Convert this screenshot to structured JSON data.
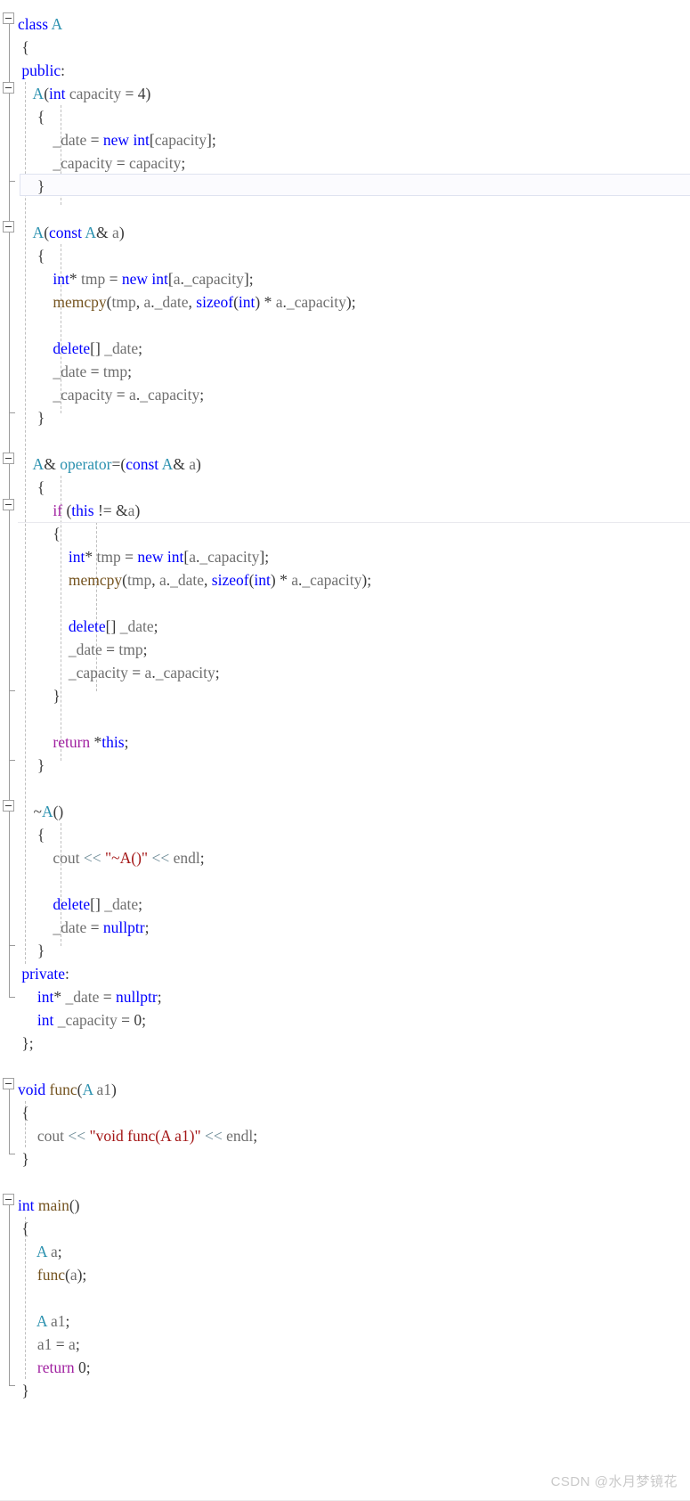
{
  "editor": {
    "app": "visual-studio-code-editor",
    "language": "C++",
    "font_size_px": 17.5,
    "line_height_px": 26,
    "background": "#ffffff",
    "current_line_index": 7,
    "colors": {
      "keyword": "#0000ff",
      "control_keyword": "#a020a0",
      "user_type": "#2b91af",
      "function": "#74531f",
      "identifier": "#6f6f6f",
      "punctuation": "#3a3a3a",
      "string": "#a31515",
      "stream_operator": "#6c8a96",
      "indent_guide": "#bfbfbf",
      "fold_spine": "#9a9a9a",
      "current_line_border": "#dfe3f0",
      "watermark": "#c9c9c9"
    }
  },
  "watermark": {
    "prefix": "CSDN",
    "handle": "@水月梦镜花",
    "full": "CSDN @水月梦镜花"
  },
  "code": {
    "lines": [
      "class A",
      "{",
      "public:",
      "    A(int capacity = 4)",
      "    {",
      "        _date = new int[capacity];",
      "        _capacity = capacity;",
      "    }",
      "",
      "    A(const A& a)",
      "    {",
      "        int* tmp = new int[a._capacity];",
      "        memcpy(tmp, a._date, sizeof(int) * a._capacity);",
      "",
      "        delete[] _date;",
      "        _date = tmp;",
      "        _capacity = a._capacity;",
      "    }",
      "",
      "    A& operator=(const A& a)",
      "    {",
      "        if (this != &a)",
      "        {",
      "            int* tmp = new int[a._capacity];",
      "            memcpy(tmp, a._date, sizeof(int) * a._capacity);",
      "",
      "            delete[] _date;",
      "            _date = tmp;",
      "            _capacity = a._capacity;",
      "        }",
      "",
      "        return *this;",
      "    }",
      "",
      "    ~A()",
      "    {",
      "        cout << \"~A()\" << endl;",
      "",
      "        delete[] _date;",
      "        _date = nullptr;",
      "    }",
      "private:",
      "    int* _date = nullptr;",
      "    int _capacity = 0;",
      "};",
      "",
      "void func(A a1)",
      "{",
      "    cout << \"void func(A a1)\" << endl;",
      "}",
      "",
      "int main()",
      "{",
      "    A a;",
      "    func(a);",
      "",
      "    A a1;",
      "    a1 = a;",
      "    return 0;",
      "}"
    ],
    "fold_markers": [
      {
        "line": 0,
        "state": "expanded",
        "label": "class A"
      },
      {
        "line": 3,
        "state": "expanded",
        "label": "A(int capacity = 4)"
      },
      {
        "line": 9,
        "state": "expanded",
        "label": "A(const A& a)"
      },
      {
        "line": 18,
        "state": "expanded",
        "label": "A& operator=(const A& a)"
      },
      {
        "line": 20,
        "state": "expanded",
        "label": "if (this != &a)"
      },
      {
        "line": 32,
        "state": "expanded",
        "label": "~A()"
      },
      {
        "line": 43,
        "state": "expanded",
        "label": "void func(A a1)"
      },
      {
        "line": 48,
        "state": "expanded",
        "label": "int main()"
      }
    ]
  }
}
